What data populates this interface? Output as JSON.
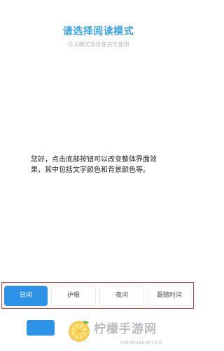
{
  "header": {
    "title": "请选择阅读模式",
    "subtitle": "日间模式适合在白天使用"
  },
  "preview": {
    "text": "您好，点击底部按钮可以改变整体界面效果，其中包括文字颜色和背景颜色等。"
  },
  "modes": {
    "day": "日间",
    "eye_care": "护眼",
    "night": "夜间",
    "follow_time": "跟随时间",
    "selected": "日间"
  },
  "watermark": {
    "brand": "柠檬手游网",
    "url": "NINGMAKEUP.COM"
  },
  "colors": {
    "accent": "#2d93e6",
    "title": "#3aa3e3",
    "highlight_frame": "#e23b3b"
  }
}
